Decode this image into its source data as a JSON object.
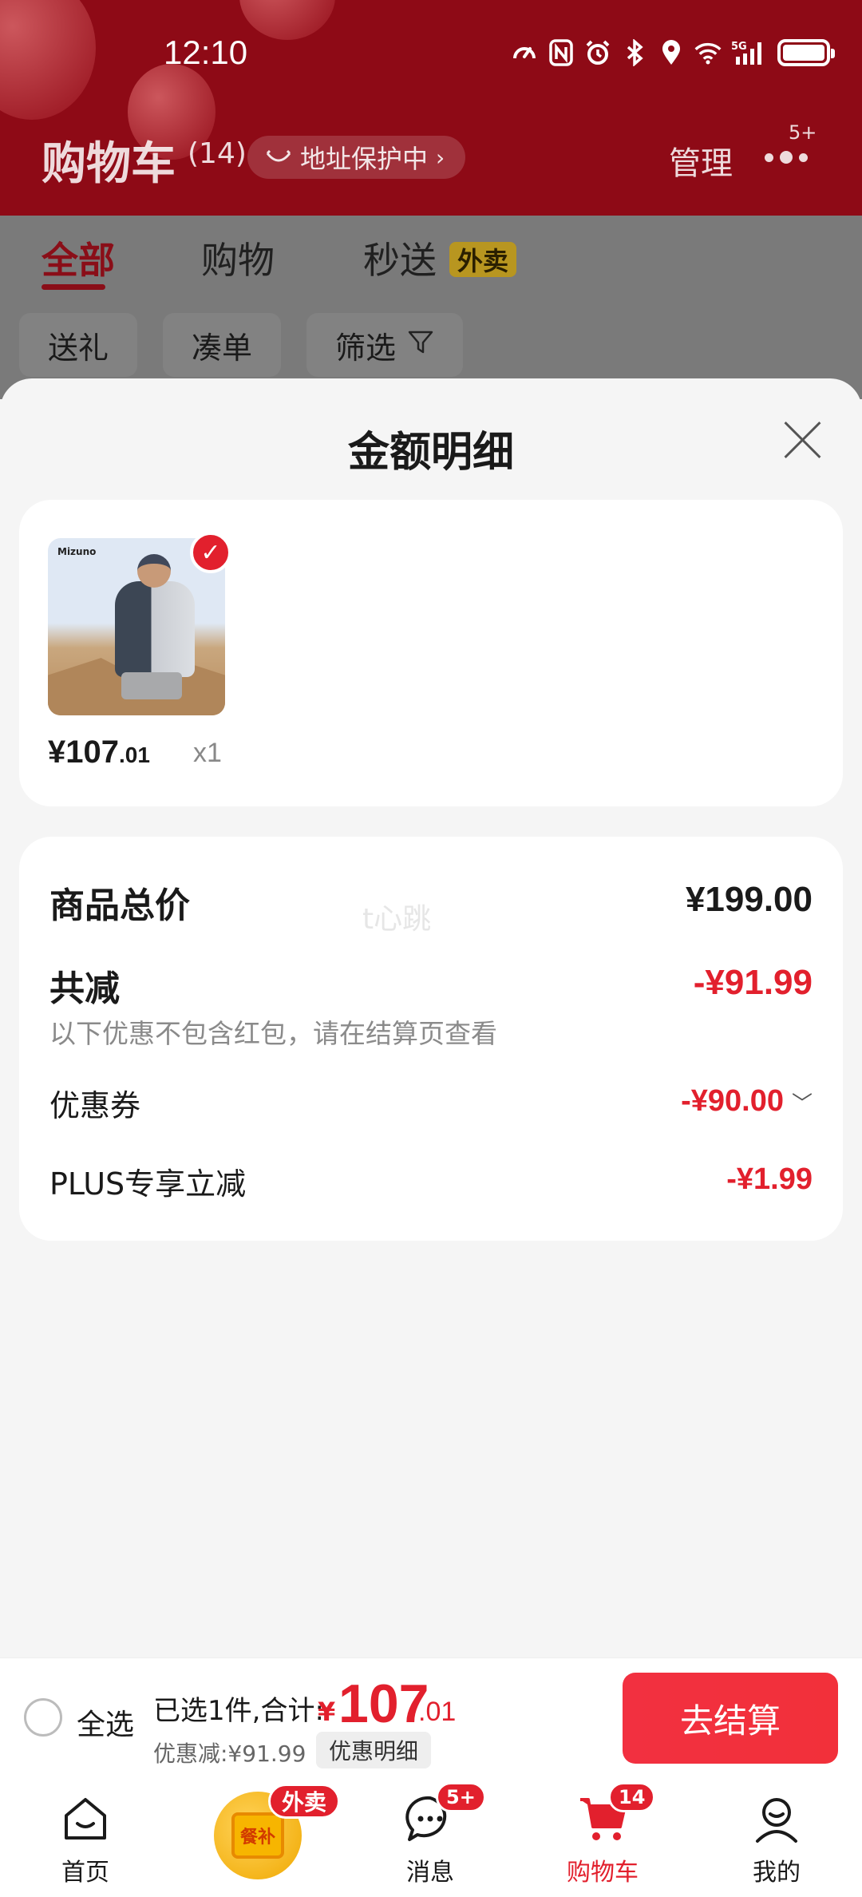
{
  "status_bar": {
    "time": "12:10",
    "network": "5G"
  },
  "header": {
    "title": "购物车",
    "count": "(14)",
    "address_protect": "地址保护中",
    "manage": "管理",
    "more_badge": "5+"
  },
  "tabs": [
    {
      "label": "全部",
      "active": true
    },
    {
      "label": "购物",
      "active": false
    },
    {
      "label": "秒送",
      "active": false
    }
  ],
  "takeout_tag": "外卖",
  "chips": [
    "送礼",
    "凑单",
    "筛选"
  ],
  "sheet": {
    "title": "金额明细",
    "product": {
      "brand": "Mizuno",
      "price_int": "¥107",
      "price_dec": ".01",
      "qty": "x1",
      "selected": true
    },
    "summary": {
      "total_label": "商品总价",
      "total_value": "¥199.00",
      "watermark": "t心跳",
      "reduce_label": "共减",
      "reduce_value": "-¥91.99",
      "reduce_note": "以下优惠不包含红包，请在结算页查看",
      "coupon_label": "优惠券",
      "coupon_value": "-¥90.00",
      "plus_label": "PLUS专享立减",
      "plus_value": "-¥1.99"
    }
  },
  "checkout": {
    "select_all": "全选",
    "selected_text": "已选1件,合计:",
    "currency": "¥",
    "total_int": "107",
    "total_dec": ".01",
    "discount_text": "优惠减:¥91.99",
    "detail_button": "优惠明细",
    "checkout_button": "去结算"
  },
  "tabbar": {
    "items": [
      {
        "label": "首页",
        "icon": "home-icon"
      },
      {
        "label": "",
        "icon": "meal-subsidy-icon",
        "badge": "外卖",
        "icon_text": "餐补"
      },
      {
        "label": "消息",
        "icon": "message-icon",
        "badge": "5+"
      },
      {
        "label": "购物车",
        "icon": "cart-icon",
        "badge": "14",
        "active": true
      },
      {
        "label": "我的",
        "icon": "profile-icon"
      }
    ]
  },
  "colors": {
    "accent": "#e2202d",
    "header": "#8e0a16",
    "tab_active": "#8a0e18"
  }
}
